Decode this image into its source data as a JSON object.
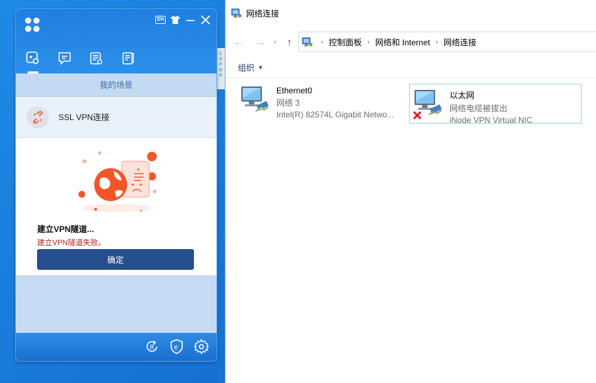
{
  "desktop": {
    "shard_text": "S\nO\nP\nO\nP"
  },
  "inode": {
    "logo_icon": "four-dots-logo-icon",
    "controls": {
      "lang": "EN",
      "skin_icon": "tshirt-icon",
      "minimize_icon": "minimize-icon",
      "close_icon": "close-icon"
    },
    "tabs": [
      {
        "icon": "scene-link-icon",
        "active": true
      },
      {
        "icon": "message-icon",
        "active": false
      },
      {
        "icon": "log-list-icon",
        "active": false
      },
      {
        "icon": "notebook-icon",
        "active": false
      }
    ],
    "scene_header": "我的场景",
    "scene_item_label": "SSL VPN连接",
    "status_title": "建立VPN隧道...",
    "status_error": "建立VPN隧道失败。",
    "confirm_label": "确定",
    "bottom_icons": [
      "refresh-r-icon",
      "shield-e-icon",
      "gear-icon"
    ],
    "colors": {
      "header_blue": "#1e7fe0",
      "confirm_button": "#264f90",
      "error_red": "#b2231e",
      "accent_orange": "#f4562c"
    }
  },
  "explorer": {
    "title": "网络连接",
    "nav": {
      "back_icon": "back-arrow-icon",
      "forward_icon": "forward-arrow-icon",
      "recent_icon": "chevron-down-icon",
      "up_icon": "up-arrow-icon"
    },
    "breadcrumbs": [
      "控制面板",
      "网络和 Internet",
      "网络连接"
    ],
    "organize_label": "组织",
    "connections": [
      {
        "name": "Ethernet0",
        "status": "网络 3",
        "device": "Intel(R) 82574L Gigabit Netwo...",
        "disconnected": false,
        "selected": false
      },
      {
        "name": "以太网",
        "status": "网络电缆被拔出",
        "device": "iNode VPN Virtual NIC",
        "disconnected": true,
        "selected": true
      }
    ]
  }
}
